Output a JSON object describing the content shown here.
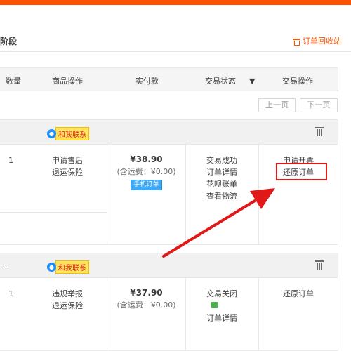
{
  "tabs": {
    "stage": "阶段",
    "recycle_bin": "订单回收站"
  },
  "table_header": {
    "qty": "数量",
    "product_ops": "商品操作",
    "amount_paid": "实付款",
    "trade_status": "交易状态",
    "status_filter_arrow": "▼",
    "trade_ops": "交易操作"
  },
  "pager": {
    "prev": "上一页",
    "next": "下一页"
  },
  "orders": [
    {
      "contact_label": "和我联系",
      "qty": "1",
      "product_ops": [
        "申请售后",
        "退运保险"
      ],
      "price": "¥38.90",
      "shipping": "(含运费：¥0.00)",
      "badge": "手机订单",
      "status": [
        "交易成功",
        "订单详情",
        "花呗账单",
        "查看物流"
      ],
      "actions": [
        "申请开票",
        "还原订单"
      ]
    },
    {
      "header_prefix": "...",
      "contact_label": "和我联系",
      "qty": "1",
      "product_ops": [
        "违规举报",
        "退运保险"
      ],
      "price": "¥37.90",
      "shipping": "(含运费：¥0.00)",
      "status": [
        "交易关闭",
        "订单详情"
      ],
      "actions": [
        "还原订单"
      ]
    }
  ],
  "colors": {
    "accent": "#ff5000",
    "annotation": "#e01818"
  }
}
